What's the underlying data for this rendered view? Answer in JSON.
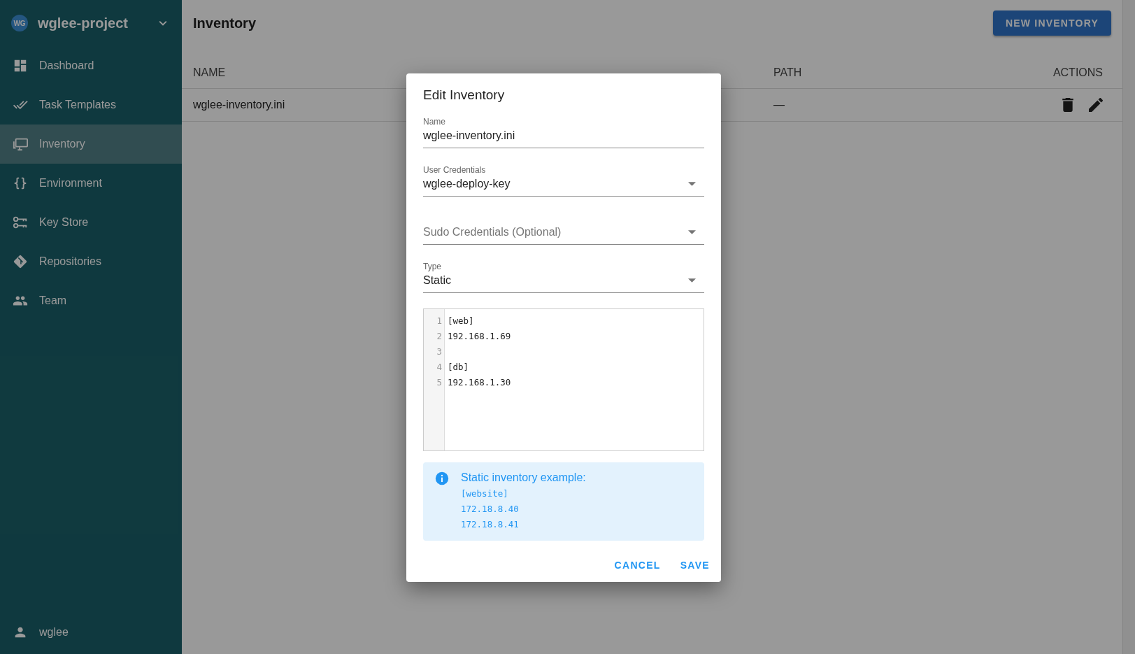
{
  "project": {
    "initials": "WG",
    "name": "wglee-project"
  },
  "sidebar": {
    "items": [
      {
        "label": "Dashboard",
        "selected": false
      },
      {
        "label": "Task Templates",
        "selected": false
      },
      {
        "label": "Inventory",
        "selected": true
      },
      {
        "label": "Environment",
        "selected": false
      },
      {
        "label": "Key Store",
        "selected": false
      },
      {
        "label": "Repositories",
        "selected": false
      },
      {
        "label": "Team",
        "selected": false
      }
    ],
    "user": "wglee"
  },
  "page": {
    "title": "Inventory",
    "new_button": "NEW INVENTORY"
  },
  "table": {
    "columns": [
      "NAME",
      "PATH",
      "ACTIONS"
    ],
    "rows": [
      {
        "name": "wglee-inventory.ini",
        "path": "—"
      }
    ]
  },
  "dialog": {
    "title": "Edit Inventory",
    "fields": [
      {
        "kind": "text",
        "label": "Name",
        "value": "wglee-inventory.ini"
      },
      {
        "kind": "select",
        "label": "User Credentials",
        "value": "wglee-deploy-key"
      },
      {
        "kind": "select",
        "placeholder": "Sudo Credentials (Optional)"
      },
      {
        "kind": "select",
        "label": "Type",
        "value": "Static"
      }
    ],
    "editor": {
      "lines": [
        {
          "number": "1",
          "text": "[web]"
        },
        {
          "number": "2",
          "text": "192.168.1.69"
        },
        {
          "number": "3"
        },
        {
          "number": "4",
          "text": "[db]"
        },
        {
          "number": "5",
          "text": "192.168.1.30"
        }
      ]
    },
    "info": {
      "title": "Static inventory example:",
      "lines": [
        "[website]",
        "172.18.8.40",
        "172.18.8.41"
      ]
    },
    "buttons": [
      "CANCEL",
      "SAVE"
    ]
  }
}
